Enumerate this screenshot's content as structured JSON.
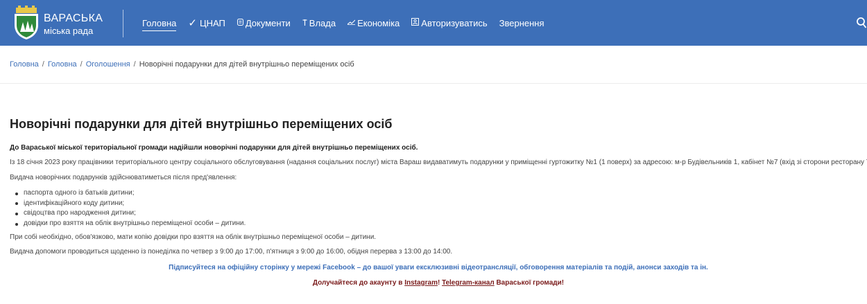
{
  "header": {
    "city_line1": "Вараська",
    "city_line2": "міська рада",
    "logo_icon": "coat-of-arms-icon",
    "background": "#3d6fb8",
    "nav": [
      {
        "label": "Головна",
        "icon": "",
        "active": true
      },
      {
        "label": "ЦНАП",
        "icon": "check-icon"
      },
      {
        "label": "Документи",
        "icon": "document-icon"
      },
      {
        "label": "Влада",
        "icon": "pin-icon"
      },
      {
        "label": "Економіка",
        "icon": "chart-icon"
      },
      {
        "label": "Авторизуватись",
        "icon": "login-icon"
      },
      {
        "label": "Звернення",
        "icon": ""
      }
    ],
    "search_icon": "search-icon"
  },
  "breadcrumb": {
    "items": [
      "Головна",
      "Головна",
      "Оголошення"
    ],
    "current": "Новорічні подарунки для дітей внутрішньо переміщених осіб",
    "separator": "/"
  },
  "article": {
    "title": "Новорічні подарунки для дітей внутрішньо переміщених осіб",
    "intro": "До Вараської міської територіальної громади надійшли новорічні подарунки для дітей внутрішньо переміщених осіб.",
    "paragraph1": "Із 18 січня 2023 року працівники територіального центру соціального обслуговування (надання соціальних послуг) міста Вараш видаватимуть подарунки у приміщенні гуртожитку №1 (1 поверх) за адресою: м-р Будівельників 1, кабінет №7 (вхід зі сторони ресторану Toscana).",
    "paragraph2": "Видача новорічних подарунків здійснюватиметься після пред'явлення:",
    "list": [
      "паспорта одного із батьків дитини;",
      "ідентифікаційного коду дитини;",
      "свідоцтва про народження дитини;",
      "довідки про взяття на облік внутрішньо переміщеної особи – дитини."
    ],
    "paragraph3": "При собі необхідно, обов'язково, мати копію довідки про взяття на облік внутрішньо переміщеної особи – дитини.",
    "paragraph4": "Видача допомоги проводиться щоденно із понеділка по четвер з 9:00 до 17:00, п'ятниця з 9:00 до 16:00, обідня перерва з 13:00 до 14:00.",
    "facebook_note": "Підписуйтеся на офіційну сторінку у мережі Facebook – до вашої уваги ексклюзивні відеотрансляції, обговорення матеріалів та подій, анонси заходів та ін.",
    "social": {
      "prefix": "Долучайтеся до акаунту в ",
      "instagram": "Instagram",
      "mid": "! ",
      "telegram": "Telegram-канал",
      "suffix": " Вараської громади!"
    },
    "link_color": "#3d6fb8",
    "accent_color": "#7a1c1c"
  }
}
